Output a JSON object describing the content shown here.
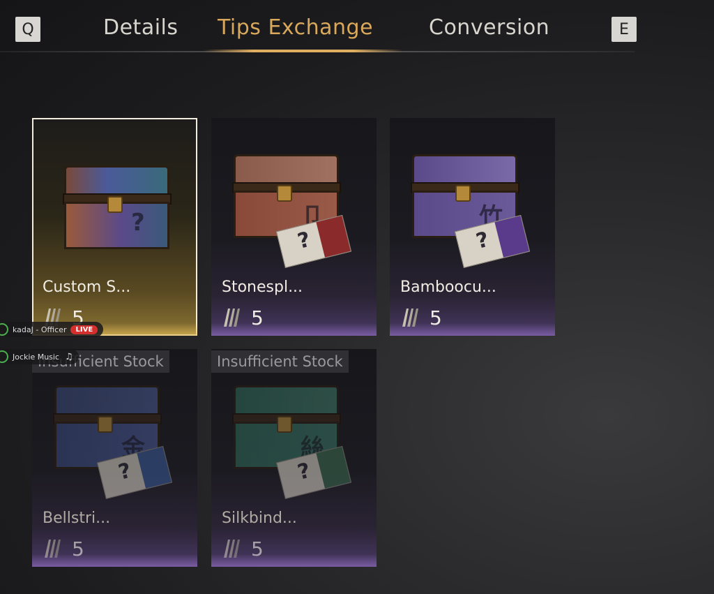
{
  "nav": {
    "prev_key": "Q",
    "next_key": "E",
    "tabs": [
      {
        "label": "Details"
      },
      {
        "label": "Tips Exchange"
      },
      {
        "label": "Conversion"
      }
    ]
  },
  "items": [
    {
      "name": "Custom S...",
      "price": "5",
      "stock": ""
    },
    {
      "name": "Stonespl...",
      "price": "5",
      "stock": ""
    },
    {
      "name": "Bamboocu...",
      "price": "5",
      "stock": ""
    },
    {
      "name": "Bellstri...",
      "price": "5",
      "stock": "Insufficient Stock"
    },
    {
      "name": "Silkbind...",
      "price": "5",
      "stock": "Insufficient Stock"
    }
  ],
  "overlay": {
    "user_label": "kadaJ - Officer",
    "live_label": "LIVE",
    "music_label": "Jockie Music"
  },
  "colors": {
    "accent": "#d9a85a",
    "selected_border": "#f2ede0",
    "stock_text": "#9a9a9e",
    "live_red": "#d32f2f"
  }
}
